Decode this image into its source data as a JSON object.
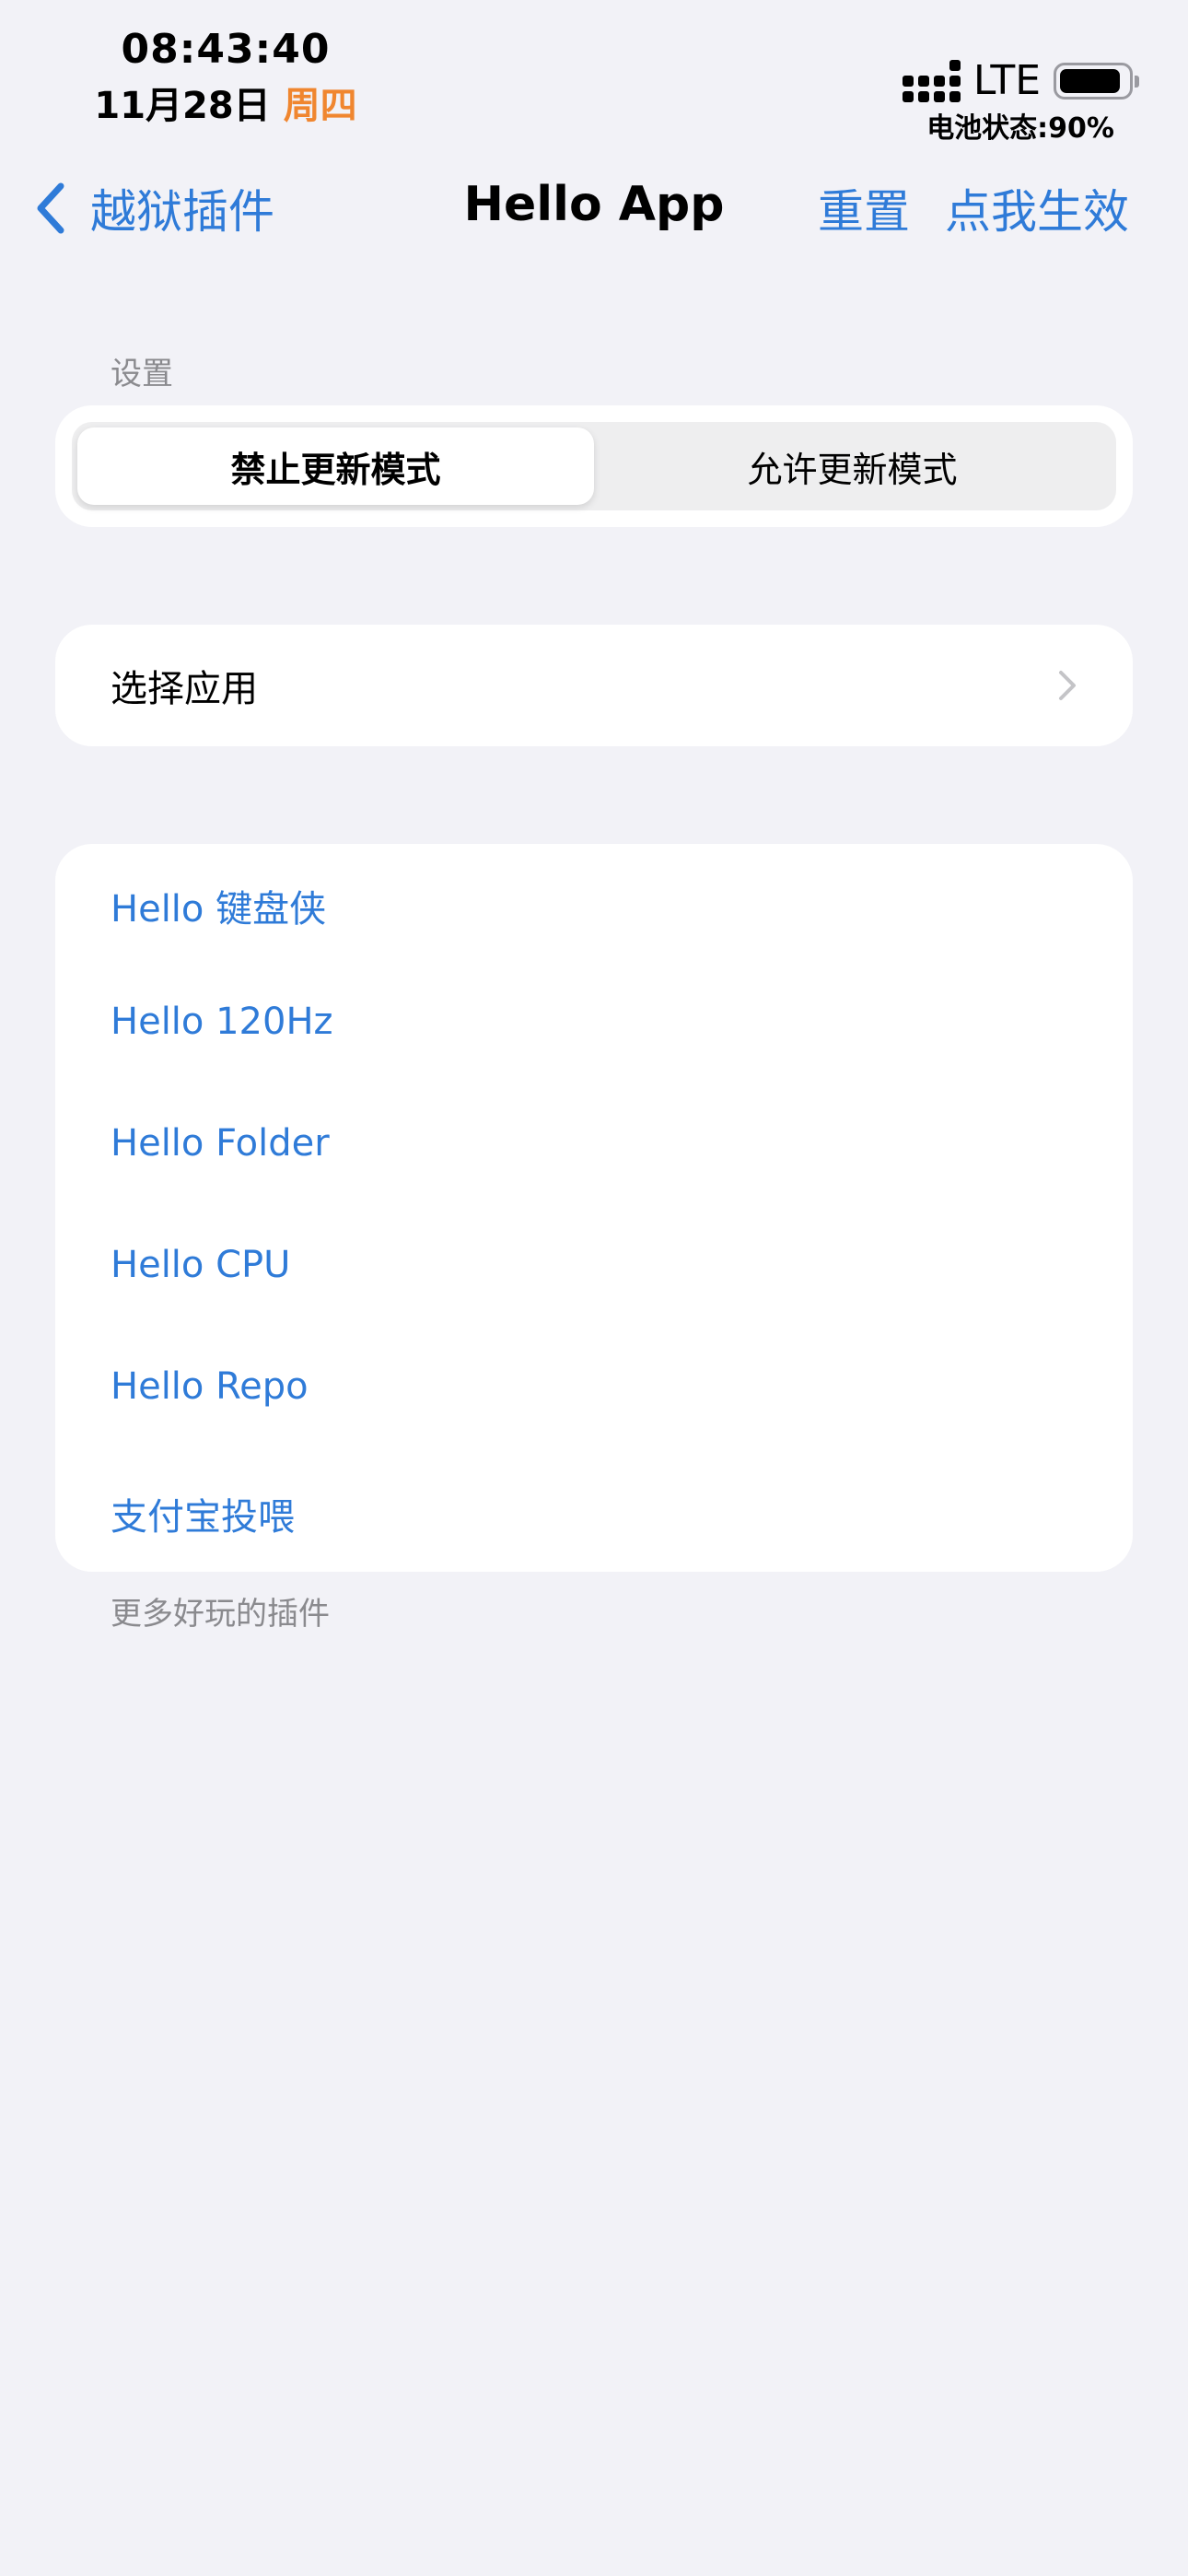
{
  "status_bar": {
    "time": "08:43:40",
    "date": "11月28日",
    "weekday": "周四",
    "network": "LTE",
    "battery_text": "电池状态:90%",
    "battery_level": 0.9
  },
  "nav": {
    "back_label": "越狱插件",
    "title": "Hello App",
    "reset_label": "重置",
    "apply_label": "点我生效"
  },
  "settings_section": {
    "header": "设置",
    "segments": [
      {
        "label": "禁止更新模式",
        "selected": true
      },
      {
        "label": "允许更新模式",
        "selected": false
      }
    ]
  },
  "select_app": {
    "label": "选择应用"
  },
  "plugins": {
    "items": [
      {
        "label": "Hello 键盘侠"
      },
      {
        "label": "Hello 120Hz"
      },
      {
        "label": "Hello Folder"
      },
      {
        "label": "Hello CPU"
      },
      {
        "label": "Hello Repo"
      },
      {
        "label": "支付宝投喂"
      }
    ],
    "footer": "更多好玩的插件"
  },
  "colors": {
    "accent": "#2f7bd8",
    "weekday": "#f0862f",
    "background": "#f2f2f7",
    "secondary_text": "#8a8a8e"
  }
}
